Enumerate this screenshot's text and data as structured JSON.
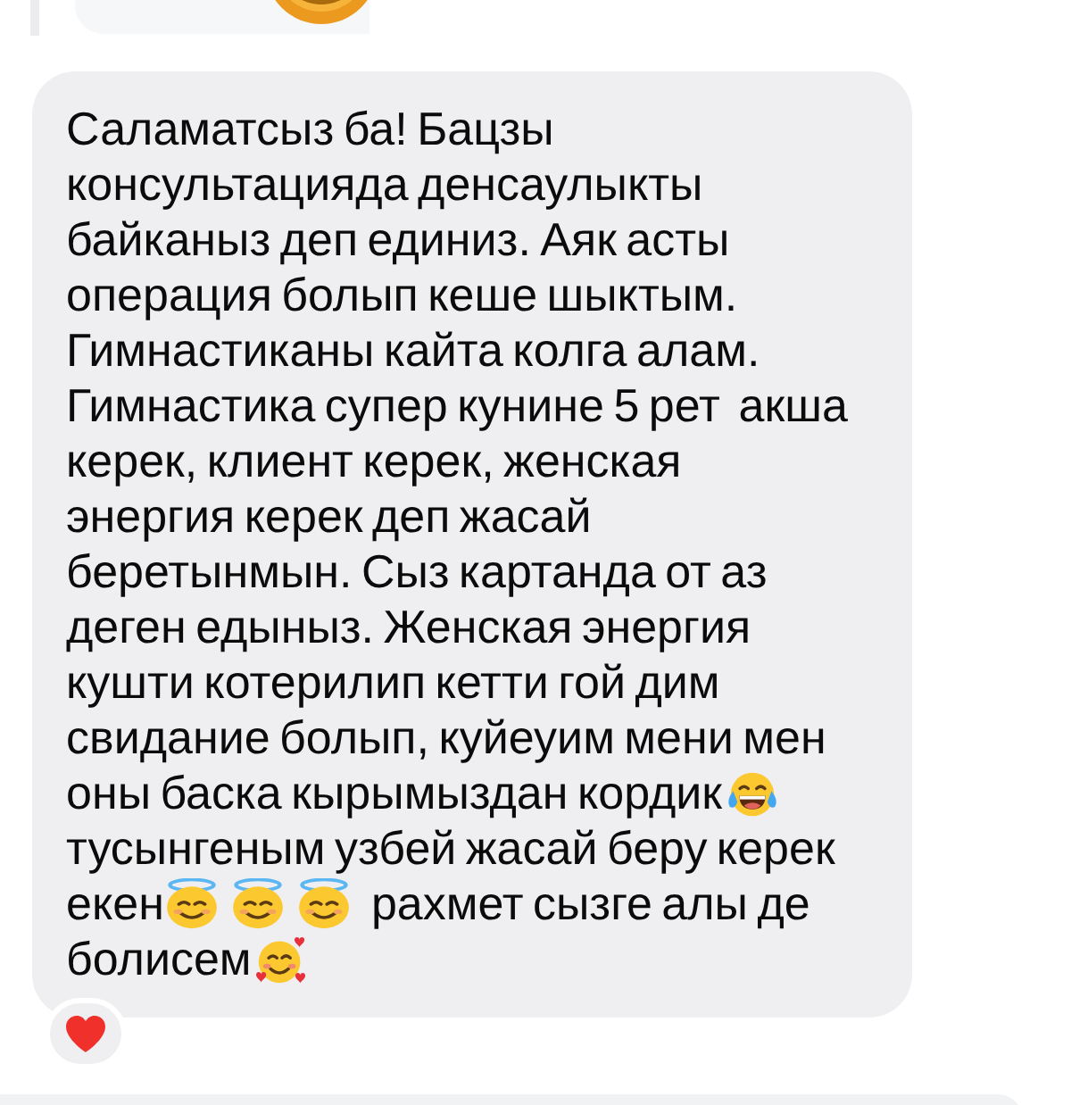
{
  "message": {
    "parts": [
      {
        "kind": "text",
        "text": "Саламатсыз ба! Бацзы консультацияда денсаулыкты байканыз деп единиз. Аяк асты операция болып кеше шыктым. Гимнастиканы кайта колга алам. Гимнастика супер кунине 5 рет  акша керек, клиент керек, женская энергия керек деп жасай беретынмын. Сыз картанда от аз деген едыныз. Женская энергия кушти котерилип кетти гой дим свидание болып, куйеуим мени мен оны баска кырымыздан кордик"
      },
      {
        "kind": "laughing"
      },
      {
        "kind": "text",
        "text": "тусынгеным узбей жасай беру керек екен"
      },
      {
        "kind": "angel"
      },
      {
        "kind": "angel"
      },
      {
        "kind": "angel"
      },
      {
        "kind": "text",
        "text": "рахмет сызге алы де болисем"
      },
      {
        "kind": "hearts"
      }
    ]
  },
  "reactions": [
    {
      "kind": "heart"
    }
  ]
}
